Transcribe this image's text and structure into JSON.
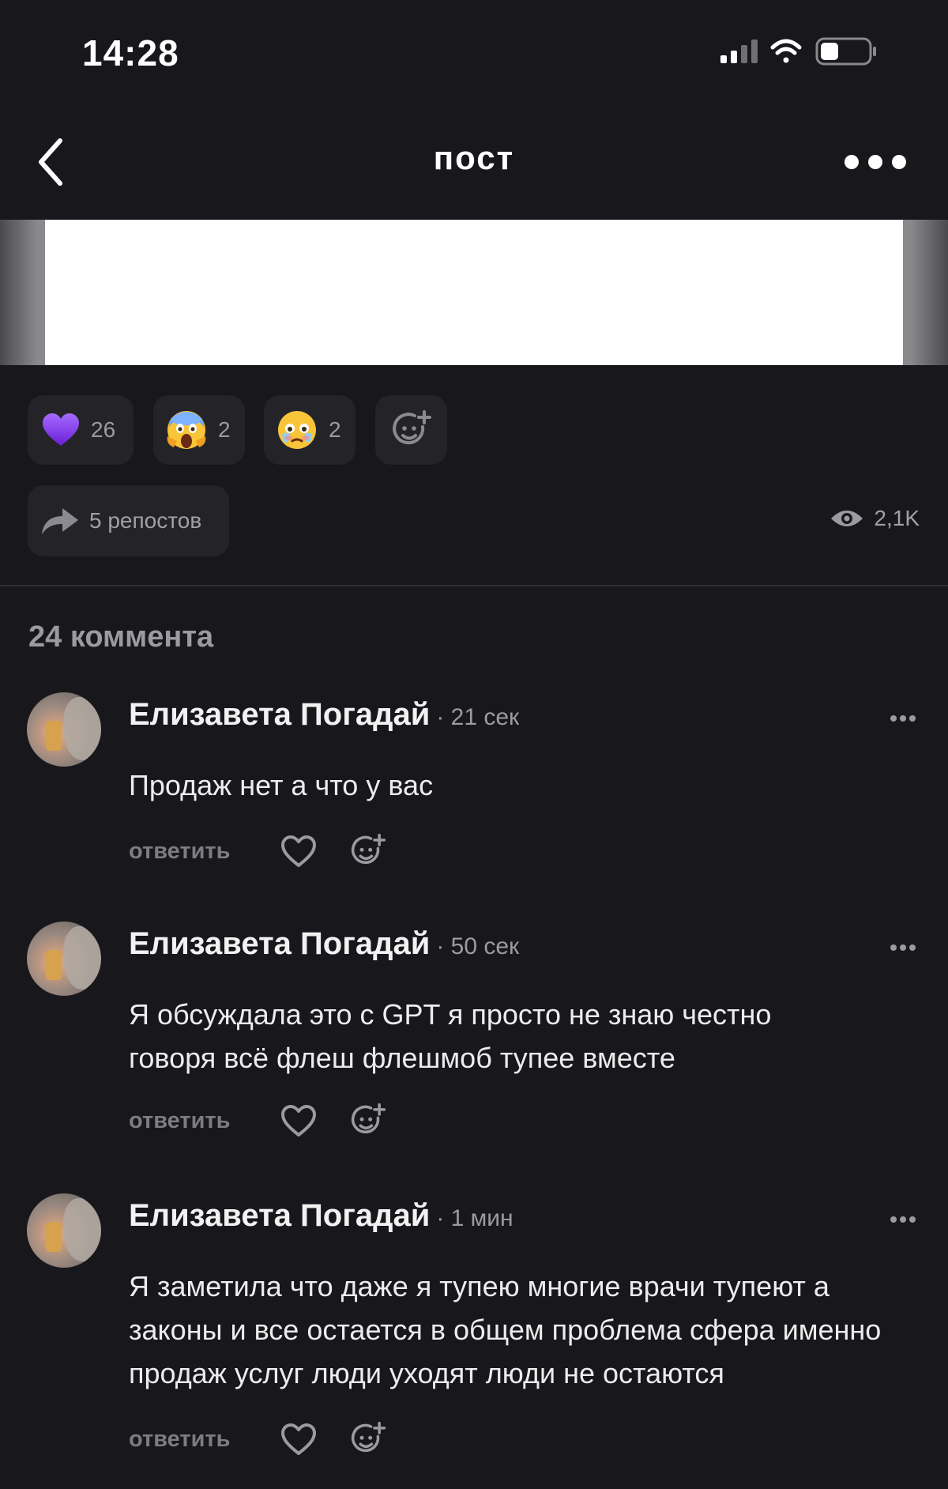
{
  "status_bar": {
    "time": "14:28",
    "icons": [
      "signal-icon",
      "wifi-icon",
      "battery-icon"
    ]
  },
  "nav": {
    "title": "пост",
    "back_icon": "chevron-left-icon",
    "more_icon": "more-horizontal-icon"
  },
  "reactions": [
    {
      "icon": "purple-heart-emoji",
      "count": "26"
    },
    {
      "icon": "screaming-face-emoji",
      "count": "2"
    },
    {
      "icon": "holding-back-tears-emoji",
      "count": "2"
    },
    {
      "icon": "add-reaction-icon",
      "count": ""
    }
  ],
  "repost": {
    "label": "5 репостов",
    "icon": "share-arrow-icon"
  },
  "views": {
    "label": "2,1K",
    "icon": "eye-icon"
  },
  "comments_header": "24 коммента",
  "comments": [
    {
      "author": "Елизавета Погадай",
      "time": "· 21 сек",
      "text": "Продаж нет а что у вас",
      "reply_label": "ответить"
    },
    {
      "author": "Елизавета Погадай",
      "time": "· 50 сек",
      "text": "Я обсуждала это с GPT я просто не знаю честно говоря всё флеш флешмоб тупее вместе",
      "reply_label": "ответить"
    },
    {
      "author": "Елизавета Погадай",
      "time": "· 1 мин",
      "text": "Я заметила что даже я тупею многие врачи тупеют а законы и все остается в общем проблема сфера именно продаж услуг люди уходят люди не остаются",
      "reply_label": "ответить"
    }
  ],
  "colors": {
    "background": "#18181c",
    "pill": "#242428",
    "muted_text": "#9a9aa0",
    "reaction_purple": "#8a3ff0"
  }
}
